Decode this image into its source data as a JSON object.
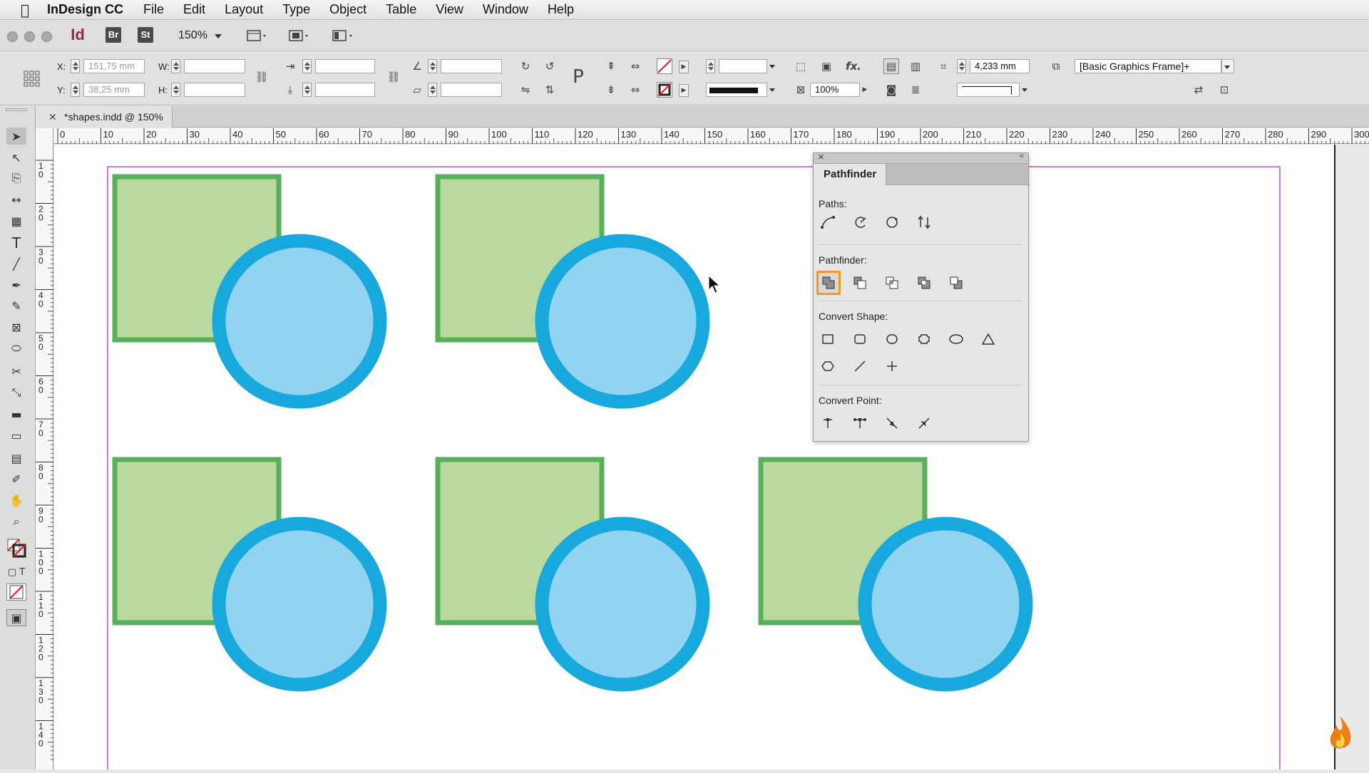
{
  "menubar": {
    "app_name": "InDesign CC",
    "items": [
      "File",
      "Edit",
      "Layout",
      "Type",
      "Object",
      "Table",
      "View",
      "Window",
      "Help"
    ]
  },
  "appbar": {
    "app_badge": "Id",
    "bridge_badge": "Br",
    "stock_badge": "St",
    "zoom": "150%"
  },
  "control": {
    "x_label": "X:",
    "y_label": "Y:",
    "w_label": "W:",
    "h_label": "H:",
    "x_value": "151,75 mm",
    "y_value": "38,25 mm",
    "stroke_weight": "4,233 mm",
    "opacity": "100%",
    "object_style": "[Basic Graphics Frame]+",
    "fx_label": "fx."
  },
  "document_tab": {
    "title": "*shapes.indd @ 150%"
  },
  "ruler": {
    "h_ticks": [
      "0",
      "10",
      "20",
      "30",
      "40",
      "50",
      "60",
      "70",
      "80",
      "90",
      "100",
      "110",
      "120",
      "130",
      "140",
      "150",
      "160",
      "170",
      "180",
      "190",
      "200",
      "210",
      "220",
      "230",
      "240",
      "250",
      "260",
      "270",
      "280",
      "290",
      "300"
    ],
    "v_ticks": [
      "1\n0",
      "2\n0",
      "3\n0",
      "4\n0",
      "5\n0",
      "6\n0",
      "7\n0",
      "8\n0",
      "9\n0",
      "1\n0\n0",
      "1\n1\n0",
      "1\n2\n0",
      "1\n3\n0",
      "1\n4\n0"
    ]
  },
  "pathfinder": {
    "title": "Pathfinder",
    "paths_label": "Paths:",
    "pathfinder_label": "Pathfinder:",
    "convert_shape_label": "Convert Shape:",
    "convert_point_label": "Convert Point:"
  },
  "colors": {
    "square_fill": "#b9d99f",
    "square_stroke": "#58b05a",
    "circle_fill": "#92d3f2",
    "circle_stroke": "#17a9de",
    "margin_guide": "#c64ad0",
    "selected_button": "#f29a1d"
  }
}
